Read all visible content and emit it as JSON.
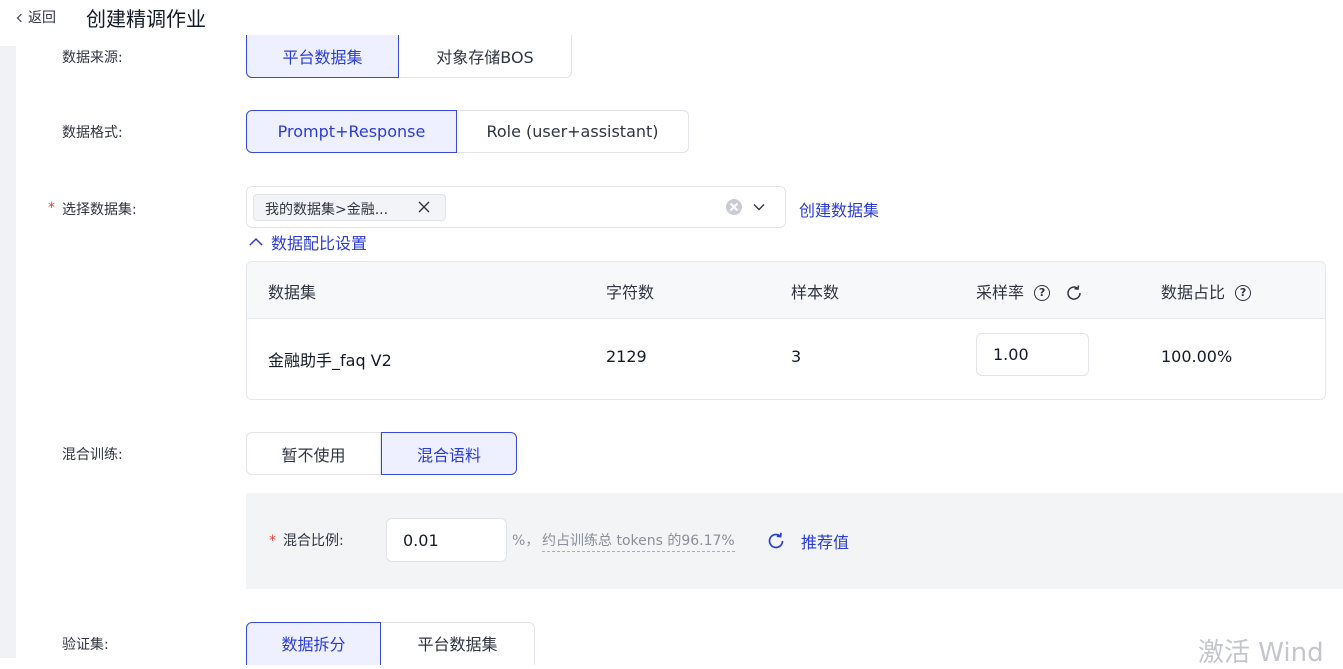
{
  "header": {
    "back_label": "返回",
    "title": "创建精调作业"
  },
  "form": {
    "data_source": {
      "label": "数据来源:",
      "options": [
        "平台数据集",
        "对象存储BOS"
      ],
      "selected": "平台数据集"
    },
    "data_format": {
      "label": "数据格式:",
      "options": [
        "Prompt+Response",
        "Role (user+assistant)"
      ],
      "selected": "Prompt+Response"
    },
    "dataset_select": {
      "required_mark": "*",
      "label": "选择数据集:",
      "tag": "我的数据集>金融...",
      "create_link": "创建数据集",
      "ratio_toggle": "数据配比设置"
    },
    "ratio_table": {
      "headers": {
        "dataset": "数据集",
        "chars": "字符数",
        "samples": "样本数",
        "sampling_rate": "采样率",
        "share": "数据占比"
      },
      "rows": [
        {
          "dataset": "金融助手_faq V2",
          "chars": "2129",
          "samples": "3",
          "sampling_rate": "1.00",
          "share": "100.00%"
        }
      ]
    },
    "mix_training": {
      "label": "混合训练:",
      "options": [
        "暂不使用",
        "混合语料"
      ],
      "selected": "混合语料",
      "ratio_required_mark": "*",
      "ratio_label": "混合比例:",
      "ratio_value": "0.01",
      "percent": "%，",
      "hint": "约占训练总 tokens 的96.17%",
      "recommend": "推荐值"
    },
    "validation": {
      "label": "验证集:",
      "options": [
        "数据拆分",
        "平台数据集"
      ],
      "selected": "数据拆分"
    }
  },
  "watermark": "激活 Wind",
  "colors": {
    "accent": "#2b3bd6",
    "required": "#e8413a",
    "panel_bg": "#f3f4f6"
  }
}
